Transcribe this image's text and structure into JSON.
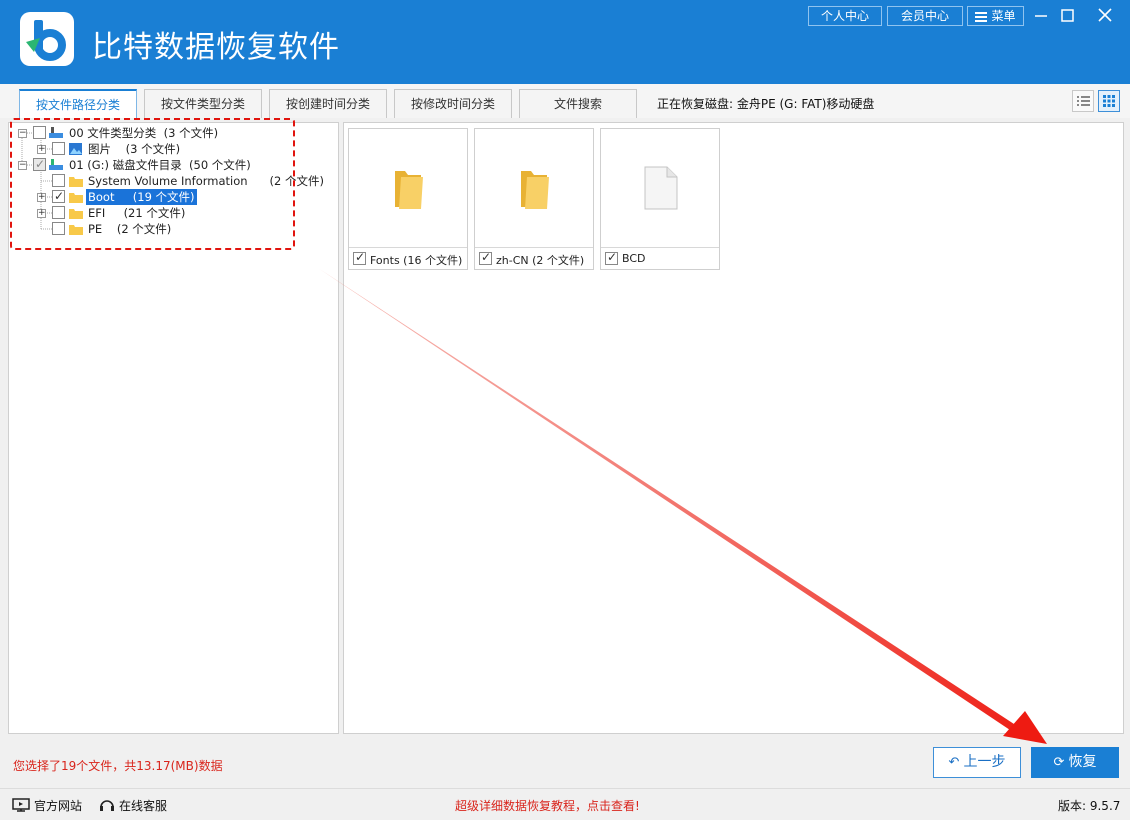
{
  "titlebar": {
    "app_title": "比特数据恢复软件",
    "personal_center": "个人中心",
    "member_center": "会员中心",
    "menu": "菜单",
    "accent_color": "#1a7fd4"
  },
  "tabs": [
    {
      "label": "按文件路径分类",
      "active": true
    },
    {
      "label": "按文件类型分类",
      "active": false
    },
    {
      "label": "按创建时间分类",
      "active": false
    },
    {
      "label": "按修改时间分类",
      "active": false
    },
    {
      "label": "文件搜索",
      "active": false
    }
  ],
  "disk_status": "正在恢复磁盘: 金舟PE (G: FAT)移动硬盘",
  "tree": {
    "nodes": [
      {
        "name": "00 文件类型分类",
        "count": "(3 个文件)"
      },
      {
        "name": "图片",
        "count": "(3 个文件)"
      },
      {
        "name": "01 (G:) 磁盘文件目录",
        "count": "(50 个文件)"
      },
      {
        "name": "System Volume Information",
        "count": "(2 个文件)"
      },
      {
        "name": "Boot",
        "count": "(19 个文件)"
      },
      {
        "name": "EFI",
        "count": "(21 个文件)"
      },
      {
        "name": "PE",
        "count": "(2 个文件)"
      }
    ]
  },
  "tiles": [
    {
      "label": "Fonts  (16 个文件)",
      "icon": "folder-icon"
    },
    {
      "label": "zh-CN  (2 个文件)",
      "icon": "folder-icon"
    },
    {
      "label": "BCD",
      "icon": "file-icon"
    }
  ],
  "status": "您选择了19个文件，共13.17(MB)数据",
  "buttons": {
    "prev": "上一步",
    "restore": "恢复"
  },
  "footer": {
    "website": "官方网站",
    "support": "在线客服",
    "tutorial": "超级详细数据恢复教程，点击查看!",
    "version": "版本: 9.5.7"
  },
  "colors": {
    "highlight": "#e1140e",
    "selection": "#1a73d9",
    "status_red": "#d9251c"
  }
}
